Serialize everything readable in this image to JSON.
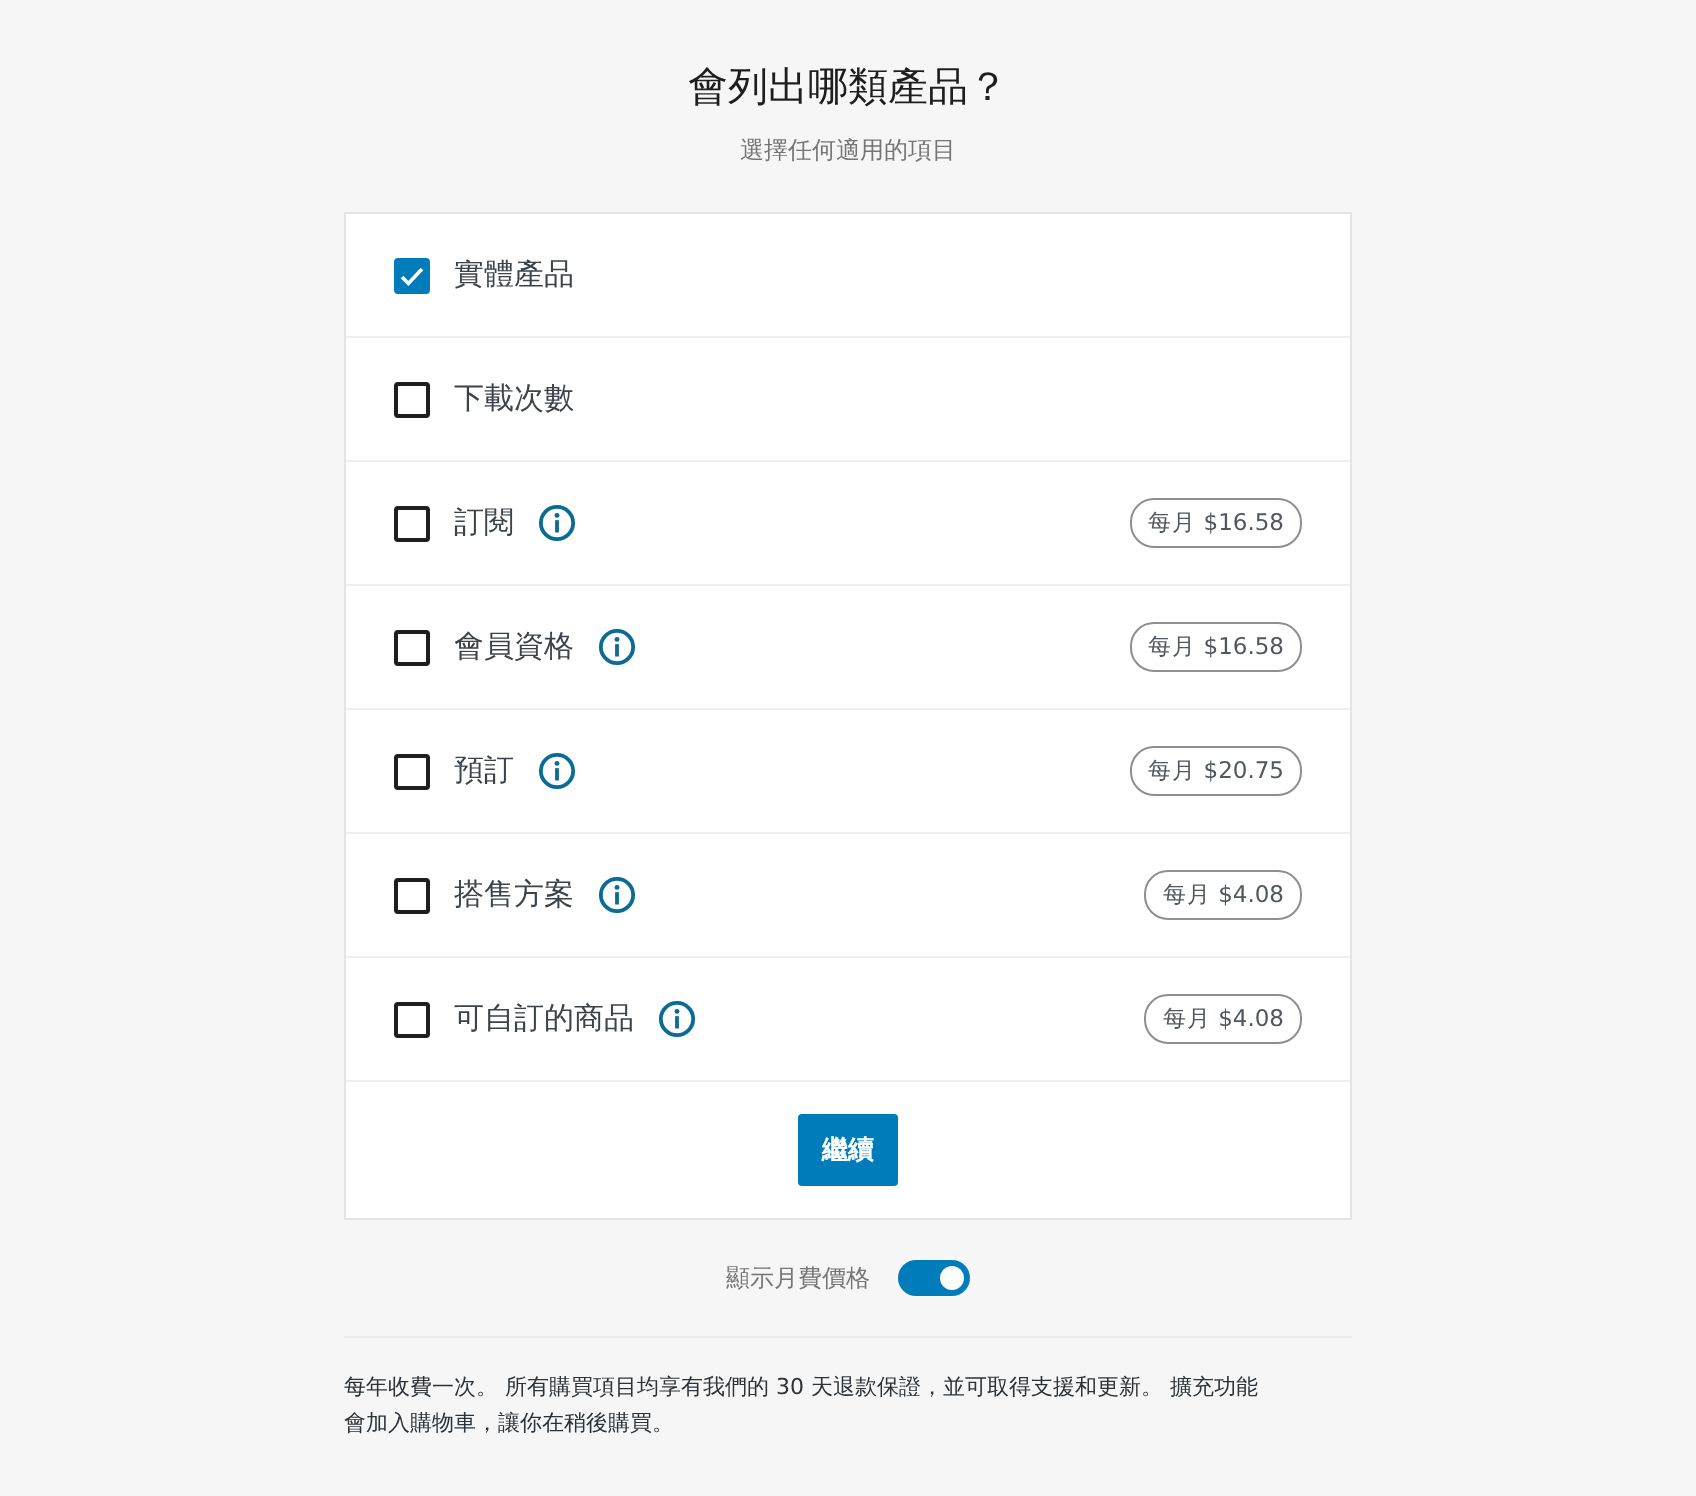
{
  "heading": {
    "title": "會列出哪類產品？",
    "subtitle": "選擇任何適用的項目"
  },
  "options": [
    {
      "label": "實體產品",
      "checked": true,
      "info": false
    },
    {
      "label": "下載次數",
      "checked": false,
      "info": false
    },
    {
      "label": "訂閱",
      "checked": false,
      "info": true,
      "price": "每月 $16.58"
    },
    {
      "label": "會員資格",
      "checked": false,
      "info": true,
      "price": "每月 $16.58"
    },
    {
      "label": "預訂",
      "checked": false,
      "info": true,
      "price": "每月 $20.75"
    },
    {
      "label": "搭售方案",
      "checked": false,
      "info": true,
      "price": "每月 $4.08"
    },
    {
      "label": "可自訂的商品",
      "checked": false,
      "info": true,
      "price": "每月 $4.08"
    }
  ],
  "continue_button": "繼續",
  "monthly_toggle": {
    "label": "顯示月費價格",
    "on": true
  },
  "footnote": "每年收費一次。 所有購買項目均享有我們的 30 天退款保證，並可取得支援和更新。 擴充功能會加入購物車，讓你在稍後購買。"
}
